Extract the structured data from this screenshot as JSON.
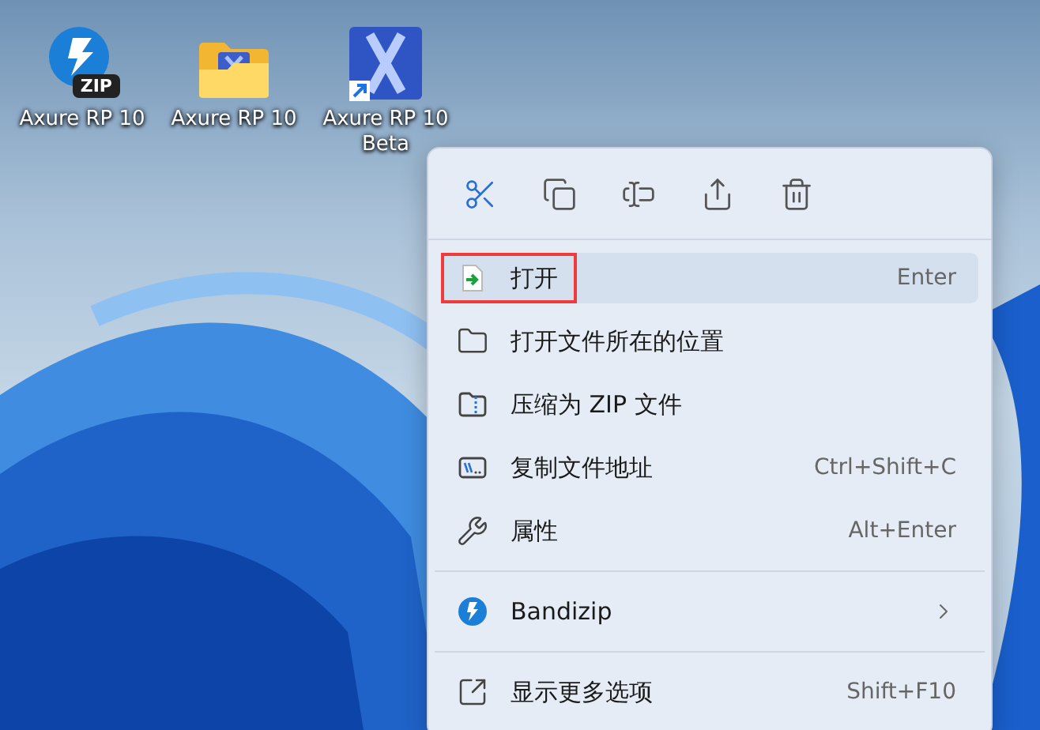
{
  "desktop_icons": [
    {
      "kind": "zip",
      "label": "Axure RP 10",
      "badge": "ZIP"
    },
    {
      "kind": "folder",
      "label": "Axure RP 10"
    },
    {
      "kind": "app",
      "label": "Axure RP 10 Beta",
      "shortcut": true
    }
  ],
  "context_menu": {
    "toolbar": [
      {
        "kind": "cut"
      },
      {
        "kind": "copy"
      },
      {
        "kind": "rename"
      },
      {
        "kind": "share"
      },
      {
        "kind": "delete"
      }
    ],
    "groups": [
      [
        {
          "kind": "open",
          "label": "打开",
          "shortcut": "Enter",
          "selected": true,
          "annotated": true
        },
        {
          "kind": "folder",
          "label": "打开文件所在的位置",
          "selected": false
        },
        {
          "kind": "zip",
          "label": "压缩为 ZIP 文件",
          "selected": false
        },
        {
          "kind": "path",
          "label": "复制文件地址",
          "shortcut": "Ctrl+Shift+C",
          "selected": false
        },
        {
          "kind": "wrench",
          "label": "属性",
          "shortcut": "Alt+Enter",
          "selected": false
        }
      ],
      [
        {
          "kind": "bandizip",
          "label": "Bandizip",
          "selected": false,
          "submenu": true
        }
      ],
      [
        {
          "kind": "more",
          "label": "显示更多选项",
          "shortcut": "Shift+F10",
          "selected": false
        }
      ]
    ]
  }
}
